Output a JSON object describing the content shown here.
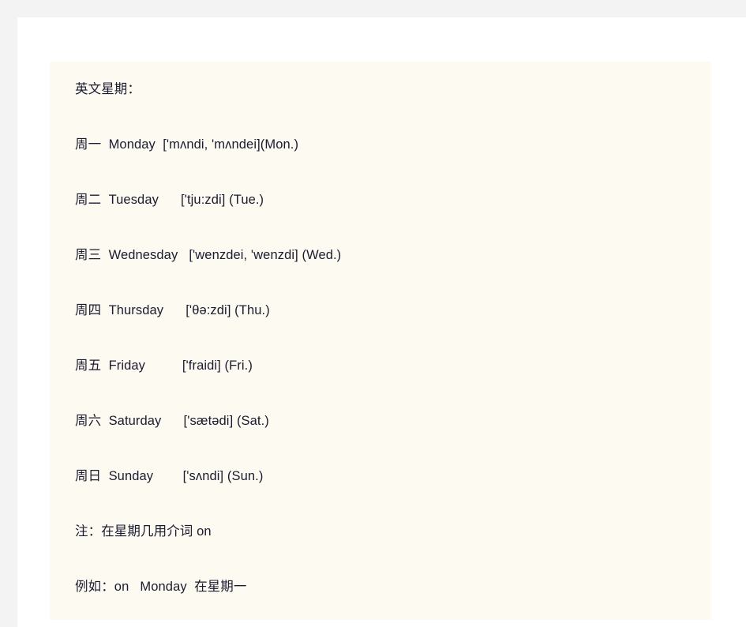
{
  "document": {
    "background_color": "#f3f3f4",
    "page_color": "#ffffff",
    "content_block_color": "#fdfaf2",
    "text_color": "#1b1b2f",
    "title": "英文星期：",
    "lines": [
      {
        "id": "title",
        "text": "英文星期："
      },
      {
        "id": "monday",
        "text": "周一  Monday  ['mʌndi, 'mʌndei](Mon.)"
      },
      {
        "id": "tuesday",
        "text": "周二  Tuesday      ['tju:zdi] (Tue.)"
      },
      {
        "id": "wednesday",
        "text": "周三  Wednesday   ['wenzdei, 'wenzdi] (Wed.)"
      },
      {
        "id": "thursday",
        "text": "周四  Thursday      ['θə:zdi] (Thu.)"
      },
      {
        "id": "friday",
        "text": "周五  Friday          ['fraidi] (Fri.)"
      },
      {
        "id": "saturday",
        "text": "周六  Saturday      ['sætədi] (Sat.)"
      },
      {
        "id": "sunday",
        "text": "周日  Sunday        ['sʌndi] (Sun.)"
      },
      {
        "id": "note",
        "text": "注：在星期几用介词 on"
      },
      {
        "id": "example",
        "text": "例如：on   Monday  在星期一"
      }
    ],
    "entries": [
      {
        "chinese": "周一",
        "english": "Monday",
        "phonetic": "['mʌndi, 'mʌndei]",
        "abbrev": "(Mon.)"
      },
      {
        "chinese": "周二",
        "english": "Tuesday",
        "phonetic": "['tju:zdi]",
        "abbrev": "(Tue.)"
      },
      {
        "chinese": "周三",
        "english": "Wednesday",
        "phonetic": "['wenzdei, 'wenzdi]",
        "abbrev": "(Wed.)"
      },
      {
        "chinese": "周四",
        "english": "Thursday",
        "phonetic": "['θə:zdi]",
        "abbrev": "(Thu.)"
      },
      {
        "chinese": "周五",
        "english": "Friday",
        "phonetic": "['fraidi]",
        "abbrev": "(Fri.)"
      },
      {
        "chinese": "周六",
        "english": "Saturday",
        "phonetic": "['sætədi]",
        "abbrev": "(Sat.)"
      },
      {
        "chinese": "周日",
        "english": "Sunday",
        "phonetic": "['sʌndi]",
        "abbrev": "(Sun.)"
      }
    ],
    "note_text": "注：在星期几用介词 on",
    "example_text": "例如：on   Monday  在星期一"
  }
}
